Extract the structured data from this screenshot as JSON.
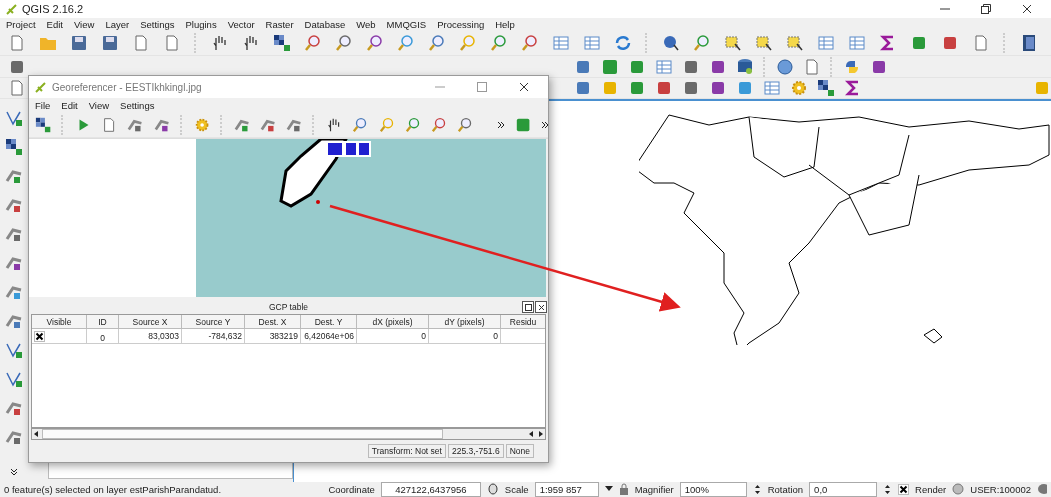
{
  "window": {
    "title": "QGIS 2.16.2"
  },
  "menu": [
    "Project",
    "Edit",
    "View",
    "Layer",
    "Settings",
    "Plugins",
    "Vector",
    "Raster",
    "Database",
    "Web",
    "MMQGIS",
    "Processing",
    "Help"
  ],
  "georeferencer": {
    "title": "Georeferencer - EESTIkhkingl.jpg",
    "menu": [
      "File",
      "Edit",
      "View",
      "Settings"
    ],
    "gcp_table": {
      "title": "GCP table",
      "columns": [
        "Visible",
        "ID",
        "Source X",
        "Source Y",
        "Dest. X",
        "Dest. Y",
        "dX (pixels)",
        "dY (pixels)",
        "Residu"
      ],
      "rows": [
        {
          "visible": true,
          "cells": [
            "",
            "0",
            "83,0303",
            "-784,632",
            "383219",
            "6,42064e+06",
            "0",
            "0",
            ""
          ]
        }
      ]
    },
    "status": [
      "Transform: Not set",
      "225.3,-751.6",
      "None"
    ]
  },
  "status_bar": {
    "message": "0 feature(s) selected on layer estParishParandatud.",
    "coordinate_label": "Coordinate",
    "coordinate": "427122,6437956",
    "scale_label": "Scale",
    "scale": "1:959 857",
    "magnifier_label": "Magnifier",
    "magnifier": "100%",
    "rotation_label": "Rotation",
    "rotation": "0,0",
    "render": {
      "label": "Render",
      "checked": true
    },
    "crs": "USER:100002"
  }
}
